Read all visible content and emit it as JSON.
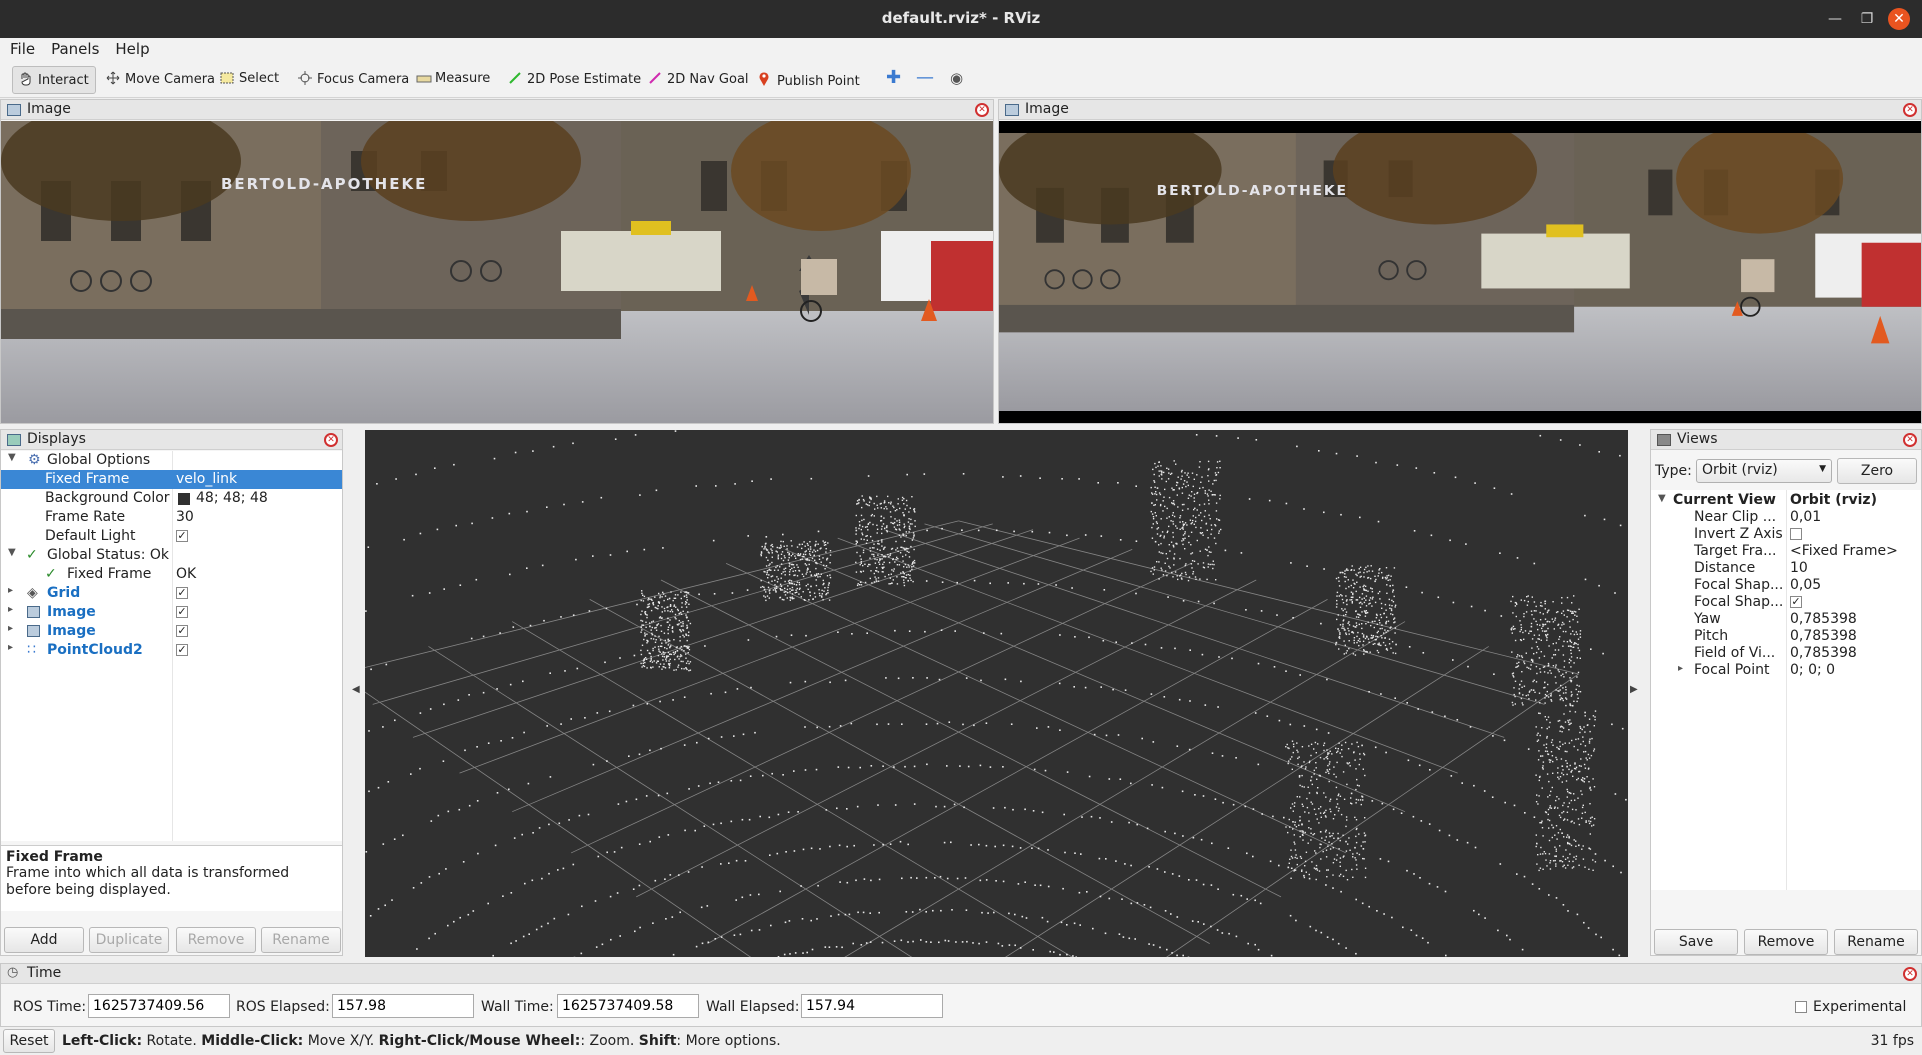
{
  "window": {
    "title": "default.rviz* - RViz"
  },
  "menu": {
    "file": "File",
    "panels": "Panels",
    "help": "Help"
  },
  "toolbar": {
    "interact": "Interact",
    "move_camera": "Move Camera",
    "select": "Select",
    "focus_camera": "Focus Camera",
    "measure": "Measure",
    "pose_estimate": "2D Pose Estimate",
    "nav_goal": "2D Nav Goal",
    "publish_point": "Publish Point",
    "add_tool_icon": "plus-icon",
    "remove_tool_icon": "minus-icon",
    "view_icon": "eye-icon"
  },
  "image_panels": [
    {
      "title": "Image"
    },
    {
      "title": "Image"
    }
  ],
  "camera_scene": {
    "sign_text": "BERTOLD-APOTHEKE"
  },
  "displays": {
    "title": "Displays",
    "rows": {
      "global_options": "Global Options",
      "fixed_frame_label": "Fixed Frame",
      "fixed_frame_value": "velo_link",
      "bg_color_label": "Background Color",
      "bg_color_value": "48; 48; 48",
      "bg_color_swatch": "#303030",
      "frame_rate_label": "Frame Rate",
      "frame_rate_value": "30",
      "default_light_label": "Default Light",
      "global_status": "Global Status: Ok",
      "status_fixed_frame_label": "Fixed Frame",
      "status_fixed_frame_value": "OK",
      "grid": "Grid",
      "image1": "Image",
      "image2": "Image",
      "pointcloud": "PointCloud2"
    },
    "help_title": "Fixed Frame",
    "help_text": "Frame into which all data is transformed before being displayed.",
    "buttons": {
      "add": "Add",
      "duplicate": "Duplicate",
      "remove": "Remove",
      "rename": "Rename"
    }
  },
  "viewport": {
    "background": "#303030",
    "grid_color": "#a0a0a0"
  },
  "views": {
    "title": "Views",
    "type_label": "Type:",
    "type_value": "Orbit (rviz)",
    "zero_button": "Zero",
    "current_view": "Current View",
    "current_view_value": "Orbit (rviz)",
    "props": [
      {
        "k": "Near Clip ...",
        "v": "0,01"
      },
      {
        "k": "Invert Z Axis",
        "v": ""
      },
      {
        "k": "Target Fra...",
        "v": "<Fixed Frame>"
      },
      {
        "k": "Distance",
        "v": "10"
      },
      {
        "k": "Focal Shap...",
        "v": "0,05"
      },
      {
        "k": "Focal Shap...",
        "v": ""
      },
      {
        "k": "Yaw",
        "v": "0,785398"
      },
      {
        "k": "Pitch",
        "v": "0,785398"
      },
      {
        "k": "Field of Vi...",
        "v": "0,785398"
      },
      {
        "k": "Focal Point",
        "v": "0; 0; 0"
      }
    ],
    "buttons": {
      "save": "Save",
      "remove": "Remove",
      "rename": "Rename"
    }
  },
  "time": {
    "title": "Time",
    "ros_time_label": "ROS Time:",
    "ros_time": "1625737409.56",
    "ros_elapsed_label": "ROS Elapsed:",
    "ros_elapsed": "157.98",
    "wall_time_label": "Wall Time:",
    "wall_time": "1625737409.58",
    "wall_elapsed_label": "Wall Elapsed:",
    "wall_elapsed": "157.94",
    "experimental": "Experimental"
  },
  "status": {
    "reset": "Reset",
    "left_click": "Left-Click:",
    "left_click_desc": "Rotate.",
    "middle_click": "Middle-Click:",
    "middle_click_desc": "Move X/Y.",
    "right_click": "Right-Click/Mouse Wheel:",
    "right_click_desc": ": Zoom.",
    "shift": "Shift",
    "shift_desc": ": More options.",
    "fps": "31 fps"
  }
}
